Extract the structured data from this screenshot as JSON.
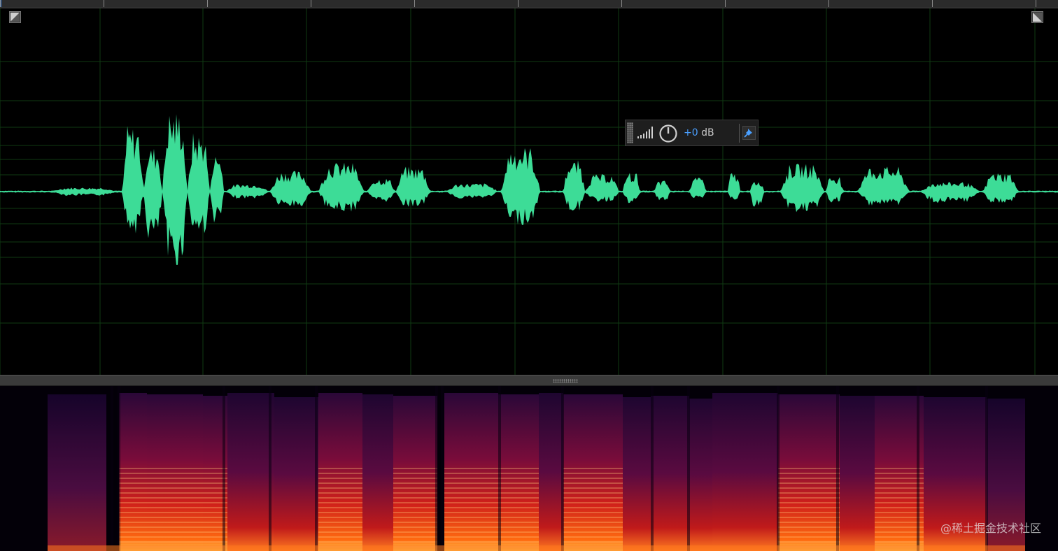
{
  "hud": {
    "gain_number": "+0",
    "gain_unit": "dB",
    "level_icon": "level-bars-icon",
    "knob_icon": "volume-knob-icon",
    "pin_icon": "pin-icon"
  },
  "watermark": "@稀土掘金技术社区",
  "colors": {
    "waveform": "#3ddc97",
    "grid": "#0f3a12",
    "background": "#000000",
    "spectrogram_hot": "#ff5a10",
    "spectrogram_mid": "#c41a1a",
    "spectrogram_low": "#3a0a4a",
    "hud_value": "#4a9fff"
  },
  "icons": {
    "left_corner": "fade-in-handle-icon",
    "right_corner": "fade-out-handle-icon",
    "divider": "resize-grip-icon"
  }
}
